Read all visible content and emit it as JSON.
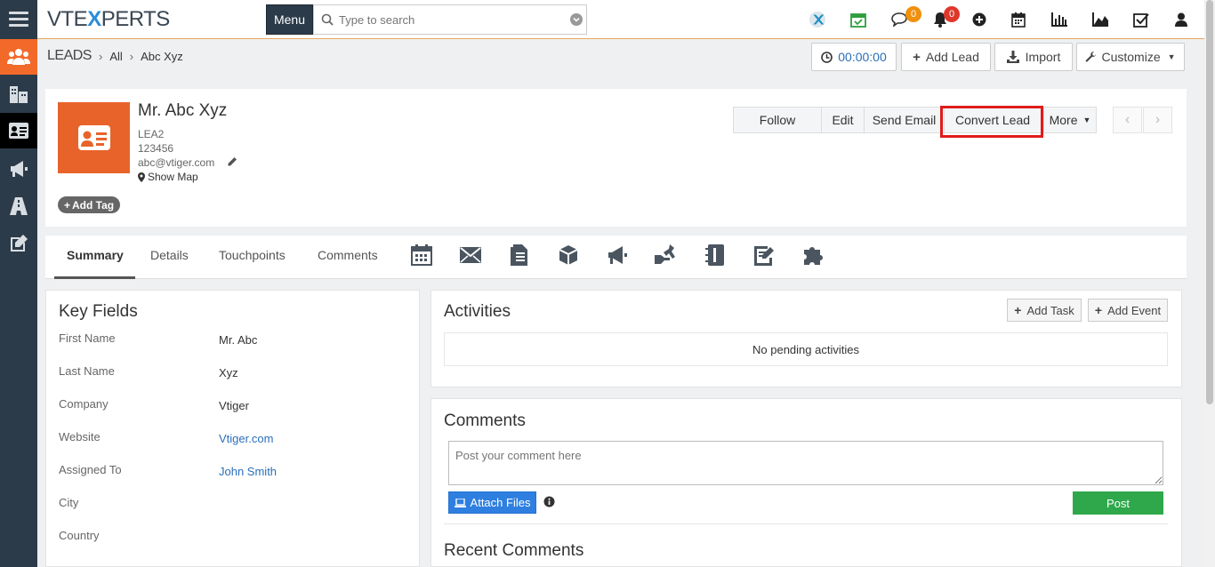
{
  "brand": {
    "logo_prefix": "VTE",
    "logo_x": "X",
    "logo_suffix": "PERTS"
  },
  "topbar": {
    "menu_label": "Menu",
    "search_placeholder": "Type to search",
    "notification_badges": {
      "chat": "0",
      "bell": "0"
    },
    "colors": {
      "chat_badge": "#f0900c",
      "bell_badge": "#e0372b"
    }
  },
  "breadcrumb": {
    "module": "LEADS",
    "filter": "All",
    "record": "Abc Xyz"
  },
  "header_actions": {
    "timer": "00:00:00",
    "add_lead": "Add Lead",
    "import": "Import",
    "customize": "Customize"
  },
  "record": {
    "name": "Mr. Abc Xyz",
    "lead_no": "LEA2",
    "phone": "123456",
    "email": "abc@vtiger.com",
    "show_map": "Show Map",
    "add_tag": "Add Tag"
  },
  "record_actions": {
    "follow": "Follow",
    "edit": "Edit",
    "send_email": "Send Email",
    "convert_lead": "Convert Lead",
    "more": "More"
  },
  "tabs": [
    "Summary",
    "Details",
    "Touchpoints",
    "Comments"
  ],
  "key_fields": {
    "title": "Key Fields",
    "rows": [
      {
        "label": "First Name",
        "value": "Mr. Abc"
      },
      {
        "label": "Last Name",
        "value": "Xyz"
      },
      {
        "label": "Company",
        "value": "Vtiger"
      },
      {
        "label": "Website",
        "value": "Vtiger.com"
      },
      {
        "label": "Assigned To",
        "value": "John Smith"
      },
      {
        "label": "City",
        "value": ""
      },
      {
        "label": "Country",
        "value": ""
      }
    ]
  },
  "activities": {
    "title": "Activities",
    "add_task": "Add Task",
    "add_event": "Add Event",
    "empty": "No pending activities"
  },
  "comments": {
    "title": "Comments",
    "placeholder": "Post your comment here",
    "attach_files": "Attach Files",
    "post": "Post",
    "recent_title": "Recent Comments"
  }
}
